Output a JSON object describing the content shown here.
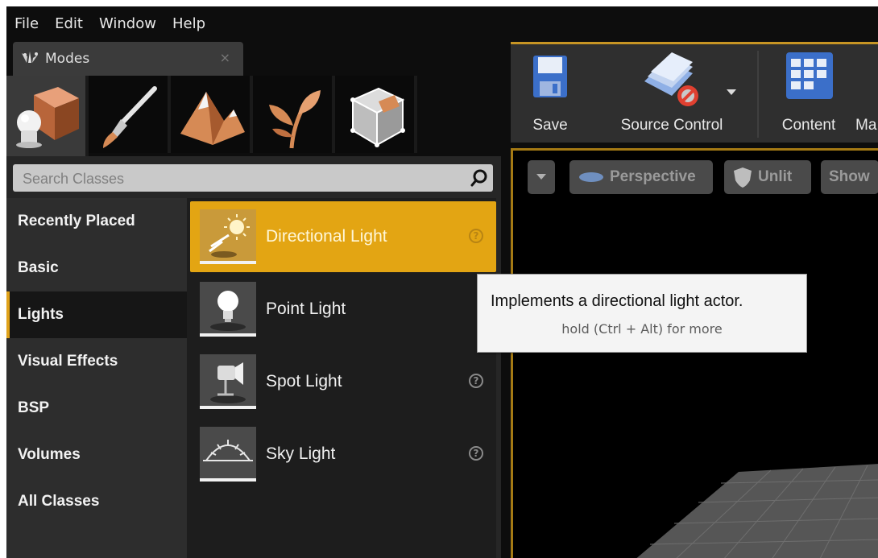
{
  "menu": [
    "File",
    "Edit",
    "Window",
    "Help"
  ],
  "modes_tab": {
    "title": "Modes",
    "close": "×"
  },
  "mode_buttons": [
    "place-mode-icon",
    "paint-mode-icon",
    "landscape-mode-icon",
    "foliage-mode-icon",
    "geometry-mode-icon"
  ],
  "search": {
    "placeholder": "Search Classes",
    "value": ""
  },
  "categories": [
    {
      "label": "Recently Placed",
      "active": false
    },
    {
      "label": "Basic",
      "active": false
    },
    {
      "label": "Lights",
      "active": true
    },
    {
      "label": "Visual Effects",
      "active": false
    },
    {
      "label": "BSP",
      "active": false
    },
    {
      "label": "Volumes",
      "active": false
    },
    {
      "label": "All Classes",
      "active": false
    }
  ],
  "items": [
    {
      "label": "Directional Light",
      "selected": true,
      "icon": "directional-light-icon"
    },
    {
      "label": "Point Light",
      "selected": false,
      "icon": "point-light-icon"
    },
    {
      "label": "Spot Light",
      "selected": false,
      "icon": "spot-light-icon"
    },
    {
      "label": "Sky Light",
      "selected": false,
      "icon": "sky-light-icon"
    }
  ],
  "toolbar": {
    "save": "Save",
    "source_control": "Source Control",
    "content": "Content",
    "marketplace_partial": "Ma"
  },
  "viewport": {
    "perspective": "Perspective",
    "unlit": "Unlit",
    "show": "Show"
  },
  "tooltip": {
    "main": "Implements a directional light actor.",
    "sub": "hold (Ctrl + Alt) for more"
  },
  "colors": {
    "accent": "#e3a513",
    "panel": "#262626",
    "background": "#0d0d0d"
  }
}
